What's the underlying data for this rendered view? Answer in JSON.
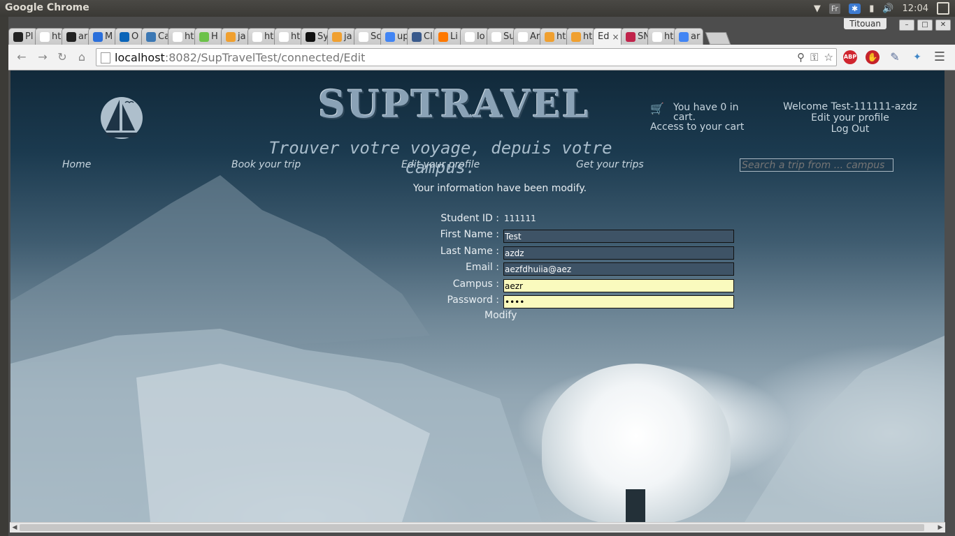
{
  "os": {
    "app_title": "Google Chrome",
    "keyboard_layout": "Fr",
    "time": "12:04"
  },
  "browser": {
    "profile_name": "Titouan",
    "tabs": [
      {
        "label": "Pl",
        "color": "#222222"
      },
      {
        "label": "ht",
        "color": "#ffffff"
      },
      {
        "label": "ar",
        "color": "#222222"
      },
      {
        "label": "M",
        "color": "#2a6fdb"
      },
      {
        "label": "O",
        "color": "#0a64b8"
      },
      {
        "label": "Ca",
        "color": "#3c78b4"
      },
      {
        "label": "ht",
        "color": "#ffffff"
      },
      {
        "label": "H",
        "color": "#6cc24a"
      },
      {
        "label": "ja",
        "color": "#f0a030"
      },
      {
        "label": "ht",
        "color": "#ffffff"
      },
      {
        "label": "ht",
        "color": "#ffffff"
      },
      {
        "label": "Sy",
        "color": "#111111"
      },
      {
        "label": "ja",
        "color": "#f0a030"
      },
      {
        "label": "Sc",
        "color": "#ffffff"
      },
      {
        "label": "up",
        "color": "#4285f4"
      },
      {
        "label": "Cl",
        "color": "#3a5a8c"
      },
      {
        "label": "Li",
        "color": "#ff7900"
      },
      {
        "label": "lo",
        "color": "#ffffff"
      },
      {
        "label": "Su",
        "color": "#ffffff"
      },
      {
        "label": "Ar",
        "color": "#ffffff"
      },
      {
        "label": "ht",
        "color": "#f0a030"
      },
      {
        "label": "ht",
        "color": "#f0a030"
      }
    ],
    "active_tab": {
      "label": "Ed",
      "close": "×"
    },
    "tabs_after": [
      {
        "label": "SN",
        "color": "#c0234b"
      },
      {
        "label": "ht",
        "color": "#ffffff"
      },
      {
        "label": "ar",
        "color": "#4285f4"
      }
    ],
    "url_host": "localhost",
    "url_rest": ":8082/SupTravelTest/connected/Edit",
    "ext_abp": "ABP"
  },
  "site": {
    "title": "SUPTRAVEL",
    "tagline": "Trouver votre voyage, depuis votre campus.",
    "cart_text": "You have 0 in cart.",
    "cart_link": "Access to your cart",
    "welcome": "Welcome Test-111111-azdz",
    "edit_profile_link": "Edit your profile",
    "logout_link": "Log Out",
    "nav": {
      "home": "Home",
      "book": "Book your trip",
      "edit": "Edit your profile",
      "trips": "Get your trips"
    },
    "search_placeholder": "Search a trip from ... campus",
    "message": "Your information have been modify.",
    "form": {
      "student_id_label": "Student ID :",
      "student_id_value": "111111",
      "first_name_label": "First Name :",
      "first_name_value": "Test",
      "last_name_label": "Last Name :",
      "last_name_value": "azdz",
      "email_label": "Email :",
      "email_value": "aezfdhuiia@aez",
      "campus_label": "Campus :",
      "campus_value": "aezr",
      "password_label": "Password :",
      "password_value": "aezr",
      "submit_label": "Modify"
    }
  }
}
